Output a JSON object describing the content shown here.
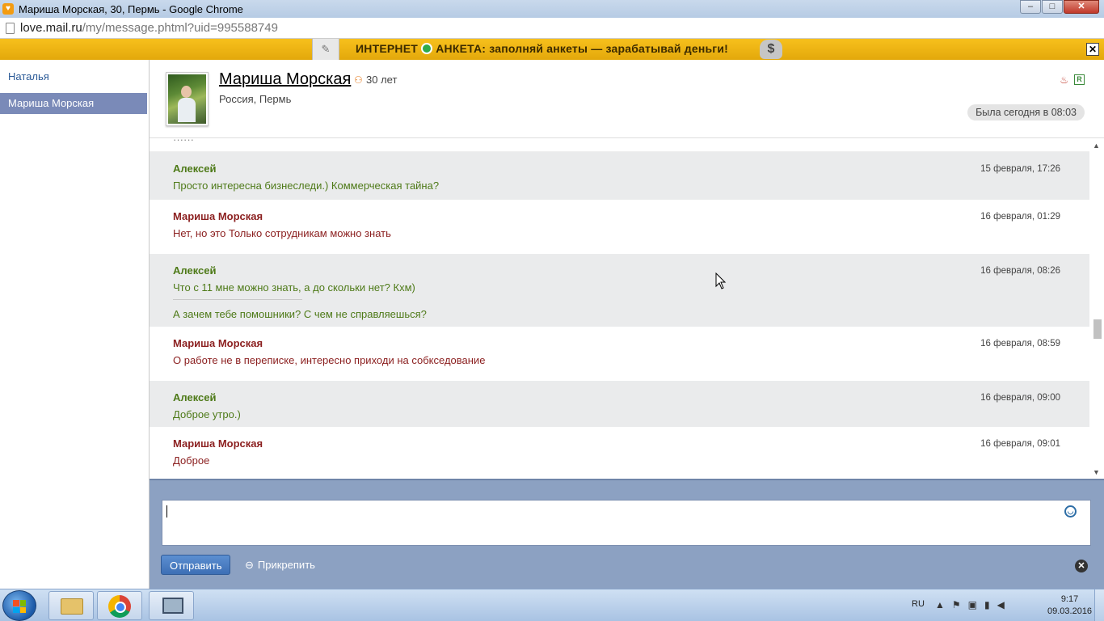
{
  "window": {
    "title": "Мариша Морская, 30, Пермь - Google Chrome",
    "minimize": "–",
    "maximize": "□",
    "close": "✕"
  },
  "address": {
    "host": "love.mail.ru",
    "path": "/my/message.phtml?uid=995588749"
  },
  "banner": {
    "text_left": "ИНТЕРНЕТ",
    "text_right": "АНКЕТА: заполняй анкеты — зарабатывай деньги!",
    "coin": "$",
    "close": "✕"
  },
  "sidebar": {
    "contacts": [
      {
        "name": "Наталья",
        "active": false
      },
      {
        "name": "Мариша Морская",
        "active": true
      }
    ]
  },
  "profile": {
    "name": "Мариша Морская",
    "age": "30 лет",
    "location": "Россия, Пермь",
    "last_seen": "Была сегодня в 08:03",
    "badge": "R"
  },
  "messages": [
    {
      "author": "Алексей",
      "text": "Просто интересна бизнеследи.) Коммерческая тайна?",
      "time": "15 февраля, 17:26",
      "side": "alexei"
    },
    {
      "author": "Мариша Морская",
      "text": "Нет, но это Только сотрудникам можно знать",
      "time": "16 февраля, 01:29",
      "side": "marisha"
    },
    {
      "author": "Алексей",
      "text": "Что с 11 мне можно знать, а до скольки нет? Кхм)",
      "text2": "А зачем тебе помошники? С чем не справляешься?",
      "time": "16 февраля, 08:26",
      "side": "alexei"
    },
    {
      "author": "Мариша Морская",
      "text": "О работе не в переписке, интересно приходи на собкседование",
      "time": "16 февраля, 08:59",
      "side": "marisha"
    },
    {
      "author": "Алексей",
      "text": "Доброе утро.)",
      "time": "16 февраля, 09:00",
      "side": "alexei"
    },
    {
      "author": "Мариша Морская",
      "text": "Доброе",
      "time": "16 февраля, 09:01",
      "side": "marisha"
    }
  ],
  "compose": {
    "send_label": "Отправить",
    "attach_label": "Прикрепить"
  },
  "taskbar": {
    "lang": "RU",
    "time": "9:17",
    "date": "09.03.2016"
  },
  "colors": {
    "alexei": "#4e7a18",
    "marisha": "#8b1f1f",
    "sidebar_active": "#7a8ab8",
    "compose_bg": "#8ca1c2",
    "banner": "#f0b514"
  }
}
